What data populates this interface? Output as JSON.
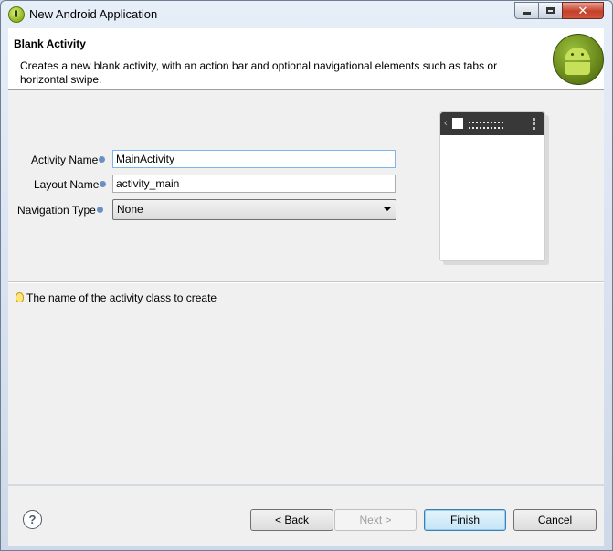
{
  "window": {
    "title": "New Android Application",
    "controls": {
      "minimize": "minimize-icon",
      "maximize": "maximize-icon",
      "close": "close-icon",
      "close_glyph": "✕"
    }
  },
  "header": {
    "title": "Blank Activity",
    "description": "Creates a new blank activity, with an action bar and optional navigational elements such as tabs or horizontal swipe.",
    "logo": "android-logo-icon"
  },
  "form": {
    "activity_name": {
      "label": "Activity Name",
      "value": "MainActivity"
    },
    "layout_name": {
      "label": "Layout Name",
      "value": "activity_main"
    },
    "navigation_type": {
      "label": "Navigation Type",
      "value": "None"
    }
  },
  "preview": {
    "back_glyph": "‹"
  },
  "hint": {
    "text": "The name of the activity class to create",
    "icon": "lightbulb-icon"
  },
  "footer": {
    "help": "?",
    "back": "< Back",
    "next": "Next >",
    "finish": "Finish",
    "cancel": "Cancel"
  },
  "colors": {
    "accent": "#7eb4ea",
    "close_button": "#c4402a",
    "android_green": "#9dc33b"
  }
}
